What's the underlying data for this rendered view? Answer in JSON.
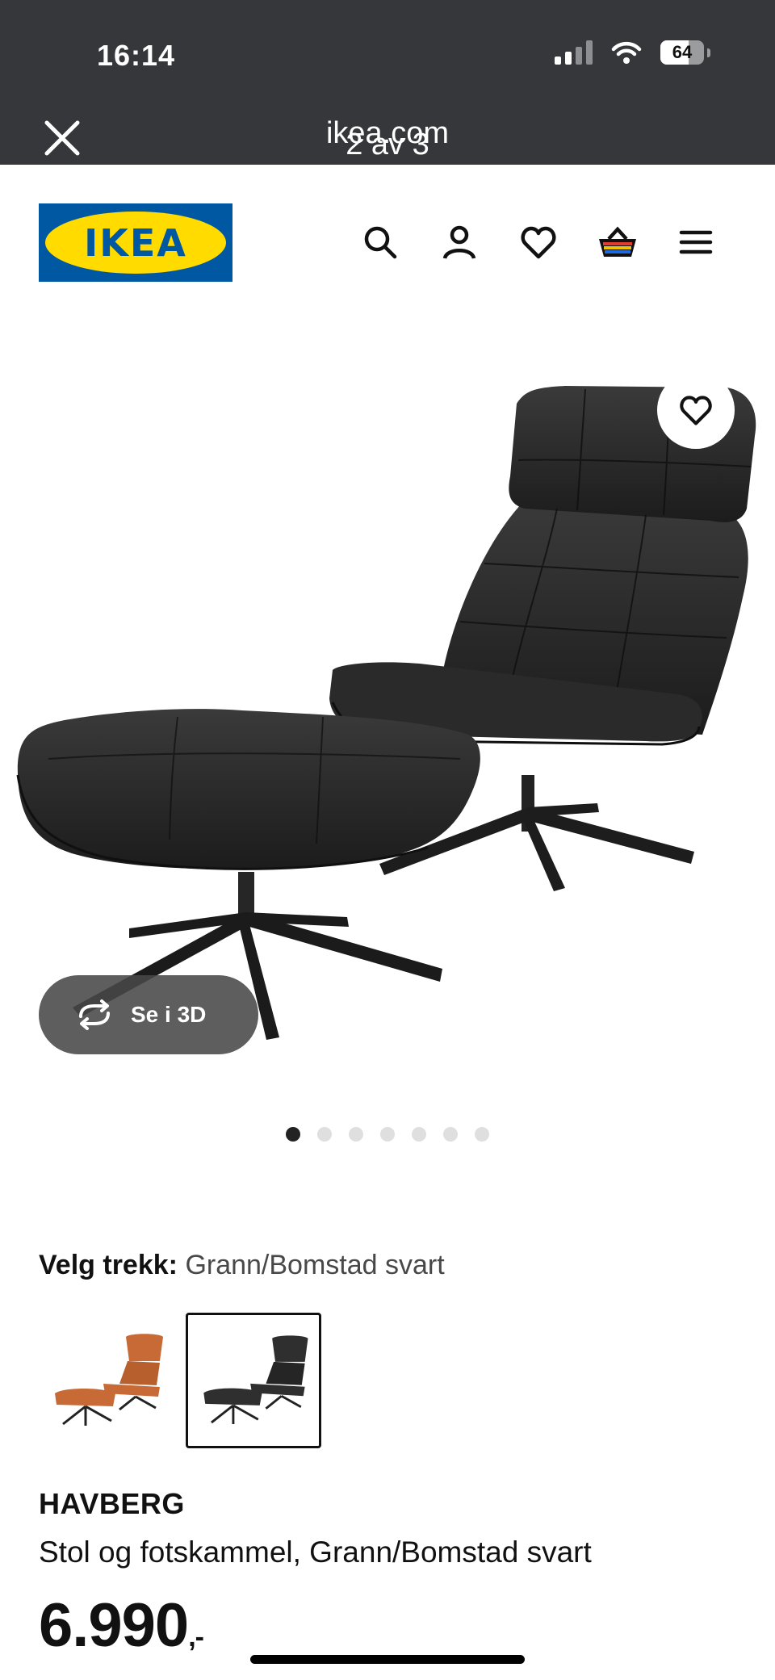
{
  "status_bar": {
    "time": "16:14",
    "battery": "64",
    "battery_level": 0.64
  },
  "browser": {
    "domain": "ikea.com",
    "counter": "2 av 3"
  },
  "header": {
    "logo_text": "IKEA",
    "icons": [
      "search-icon",
      "account-icon",
      "favorites-icon",
      "basket-icon",
      "menu-icon"
    ]
  },
  "gallery": {
    "view_3d_label": "Se i 3D",
    "dot_count": 7,
    "active_dot": 0
  },
  "cover": {
    "label": "Velg trekk:",
    "value": "Grann/Bomstad svart",
    "options": [
      {
        "color": "#c76a35",
        "selected": false
      },
      {
        "color": "#2f2f30",
        "selected": true
      }
    ]
  },
  "product": {
    "name": "HAVBERG",
    "description": "Stol og fotskammel, Grann/Bomstad svart",
    "price": "6.990",
    "price_suffix": ",-"
  },
  "colors": {
    "topbar": "#36373a",
    "ikea_blue": "#0058a3",
    "ikea_yellow": "#ffdb00"
  }
}
